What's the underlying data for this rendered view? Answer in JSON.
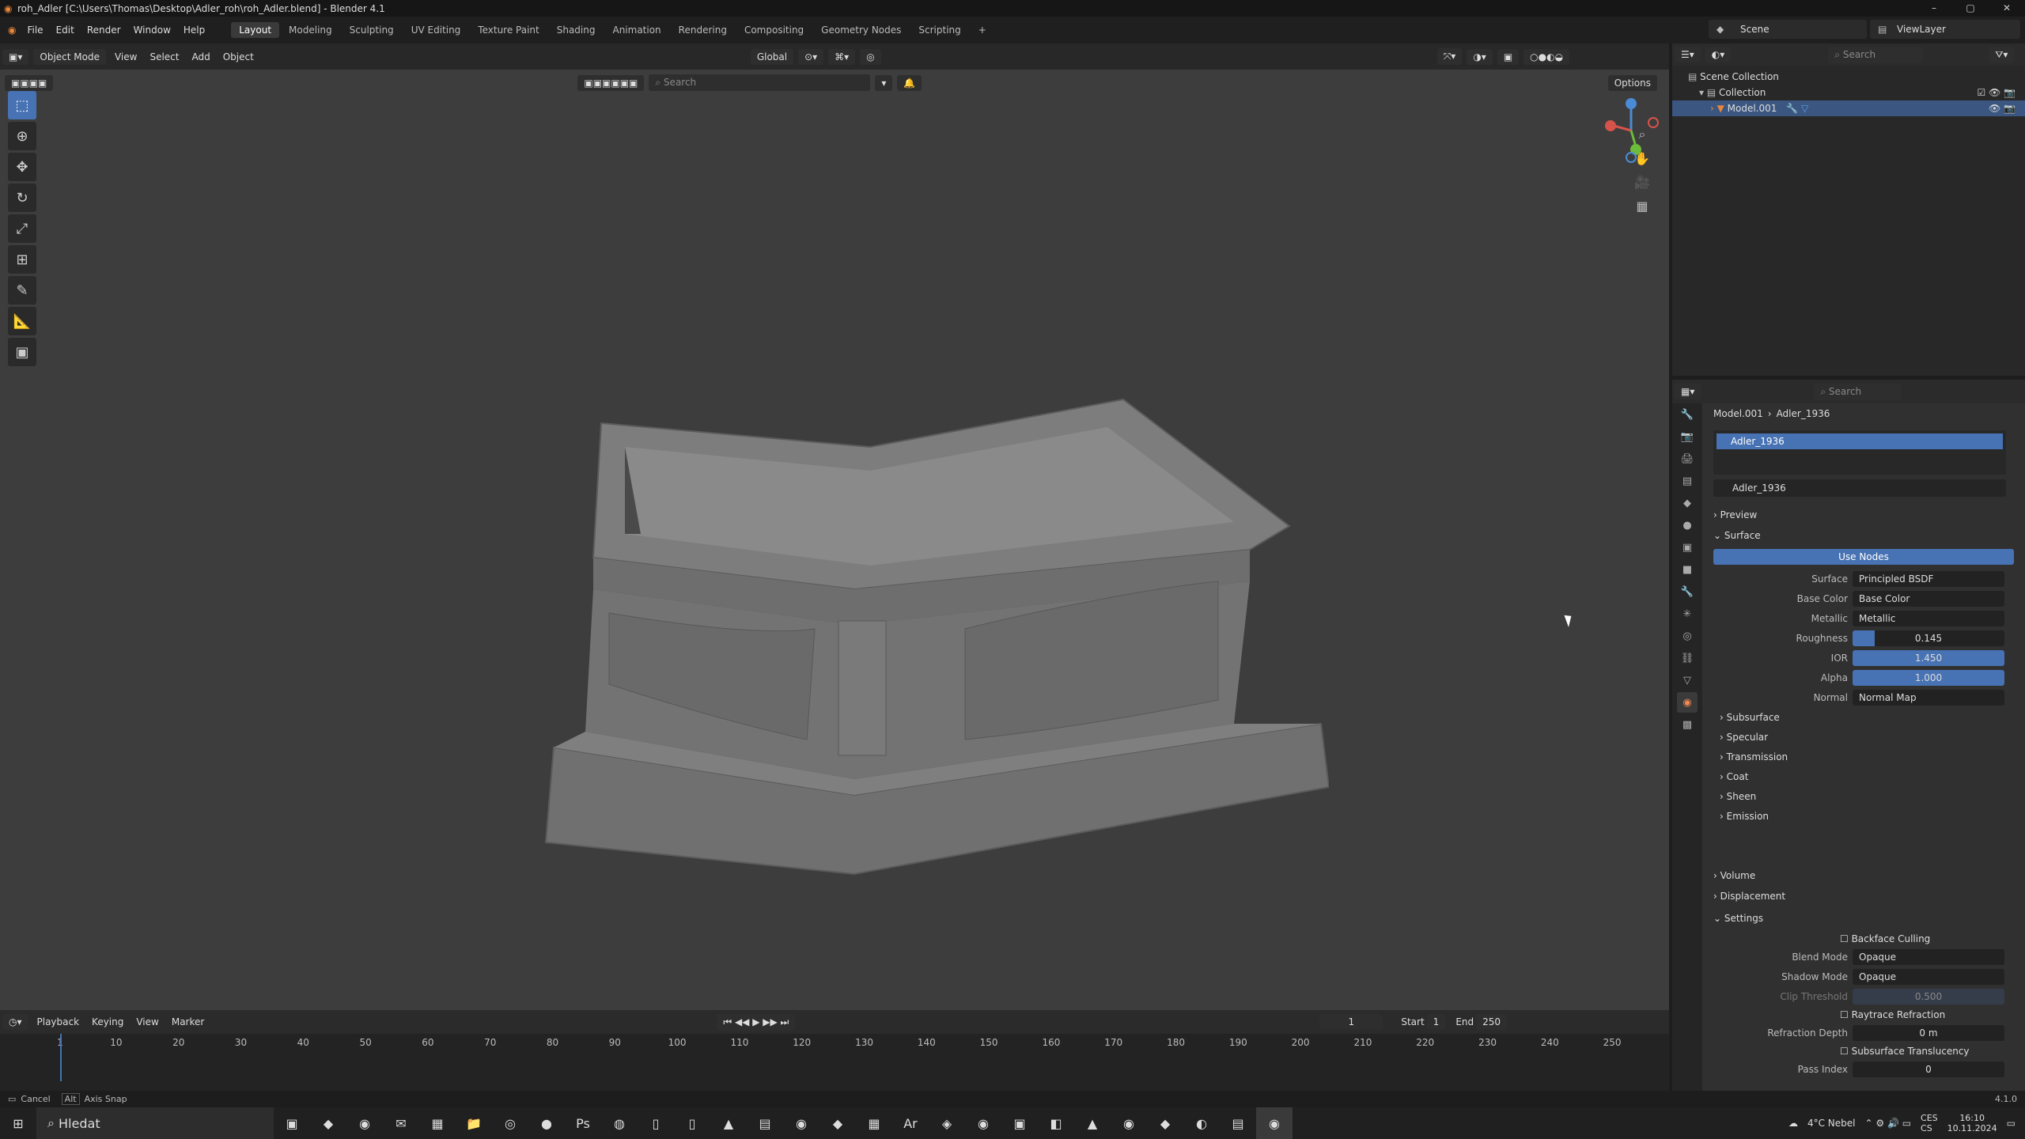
{
  "window": {
    "title": "roh_Adler [C:\\Users\\Thomas\\Desktop\\Adler_roh\\roh_Adler.blend] - Blender 4.1",
    "controls": [
      "–",
      "▢",
      "✕"
    ]
  },
  "menubar": {
    "items": [
      "File",
      "Edit",
      "Render",
      "Window",
      "Help"
    ],
    "workspaces": [
      "Layout",
      "Modeling",
      "Sculpting",
      "UV Editing",
      "Texture Paint",
      "Shading",
      "Animation",
      "Rendering",
      "Compositing",
      "Geometry Nodes",
      "Scripting"
    ],
    "active_workspace": "Layout",
    "scene": "Scene",
    "viewlayer": "ViewLayer"
  },
  "viewport": {
    "mode": "Object Mode",
    "menus": [
      "View",
      "Select",
      "Add",
      "Object"
    ],
    "transform": "Global",
    "options_label": "Options",
    "search_placeholder": "Search",
    "tools": [
      "select-box",
      "cursor",
      "move",
      "rotate",
      "scale",
      "transform",
      "annotate",
      "measure",
      "add-cube"
    ]
  },
  "outliner": {
    "search_placeholder": "Search",
    "rows": [
      "Scene Collection",
      "Collection",
      "Model.001"
    ]
  },
  "properties": {
    "search_placeholder": "Search",
    "breadcrumb": [
      "Model.001",
      "Adler_1936"
    ],
    "material_slot": "Adler_1936",
    "material_name": "Adler_1936",
    "sections": {
      "preview": "Preview",
      "surface": "Surface",
      "use_nodes": "Use Nodes",
      "volume": "Volume",
      "displacement": "Displacement",
      "settings": "Settings"
    },
    "surface_rows": [
      {
        "label": "Surface",
        "value": "Principled BSDF"
      },
      {
        "label": "Base Color",
        "value": "Base Color"
      },
      {
        "label": "Metallic",
        "value": "Metallic"
      },
      {
        "label": "Roughness",
        "value": "0.145"
      },
      {
        "label": "IOR",
        "value": "1.450"
      },
      {
        "label": "Alpha",
        "value": "1.000"
      },
      {
        "label": "Normal",
        "value": "Normal Map"
      }
    ],
    "roughness_fill": 0.145,
    "subpanels": [
      "Subsurface",
      "Specular",
      "Transmission",
      "Coat",
      "Sheen",
      "Emission"
    ],
    "settings": {
      "backface_culling": "Backface Culling",
      "blend_mode_label": "Blend Mode",
      "blend_mode": "Opaque",
      "shadow_mode_label": "Shadow Mode",
      "shadow_mode": "Opaque",
      "clip_threshold_label": "Clip Threshold",
      "clip_threshold": "0.500",
      "raytrace_refraction": "Raytrace Refraction",
      "refraction_depth_label": "Refraction Depth",
      "refraction_depth": "0 m",
      "subsurface_translucency": "Subsurface Translucency",
      "pass_index_label": "Pass Index",
      "pass_index": "0"
    }
  },
  "timeline": {
    "menus": [
      "Playback",
      "Keying",
      "View",
      "Marker"
    ],
    "current_frame": "1",
    "start_label": "Start",
    "start": "1",
    "end_label": "End",
    "end": "250",
    "ticks": [
      "1",
      "10",
      "20",
      "30",
      "40",
      "50",
      "60",
      "70",
      "80",
      "90",
      "100",
      "110",
      "120",
      "130",
      "140",
      "150",
      "160",
      "170",
      "180",
      "190",
      "200",
      "210",
      "220",
      "230",
      "240",
      "250"
    ]
  },
  "statusbar": {
    "left1": "Cancel",
    "left2": "Axis Snap",
    "version": "4.1.0"
  },
  "taskbar": {
    "search": "Hledat",
    "weather": "4°C  Nebel",
    "lang": "CES",
    "lang2": "CS",
    "time": "16:10",
    "date": "10.11.2024"
  },
  "colors": {
    "accent": "#4772b3",
    "active_tab": "#e85",
    "selection": "#3b5681"
  }
}
